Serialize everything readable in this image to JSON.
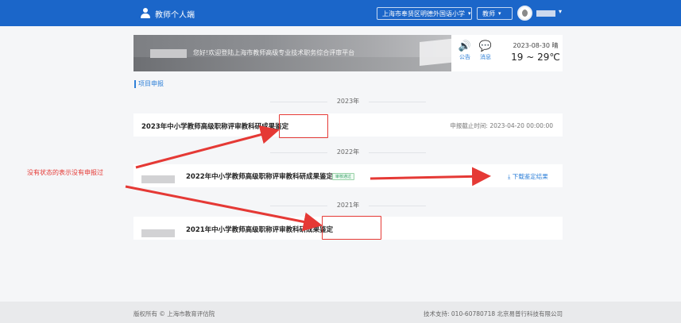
{
  "header": {
    "title": "教师个人端",
    "school": "上海市奉贤区明德外国语小学",
    "role": "教师",
    "chevron": "▾",
    "icons": {
      "brand": "user-icon",
      "avatar": "avatar-icon"
    }
  },
  "banner": {
    "welcome": "您好!欢迎登陆上海市教师高级专业技术职务综合评审平台",
    "notice_label": "公告",
    "message_label": "消息",
    "notice_glyph": "🔊",
    "message_glyph": "💬",
    "date": "2023-08-30 晴",
    "temperature": "19 ~ 29℃"
  },
  "section": {
    "title": "项目申报"
  },
  "years": [
    {
      "year": "2023年",
      "project": "2023年中小学教师高级职称评审教科研成果鉴定",
      "deadline": "申报截止时间: 2023-04-20 00:00:00"
    },
    {
      "year": "2022年",
      "project": "2022年中小学教师高级职称评审教科研成果鉴定",
      "status": "审核通过",
      "download": "⤓ 下载鉴定结果"
    },
    {
      "year": "2021年",
      "project": "2021年中小学教师高级职称评审教科研成果鉴定"
    }
  ],
  "annotation": {
    "note": "没有状态的表示没有申报过",
    "color": "#e53935"
  },
  "footer": {
    "copyright": "版权所有 © 上海市教育评估院",
    "support": "技术支持: 010-60780718 北京易普行科技有限公司"
  },
  "colors": {
    "topbar": "#1b66c9",
    "accent": "#2f80d8",
    "success": "#38a169",
    "annotation": "#e53935"
  }
}
